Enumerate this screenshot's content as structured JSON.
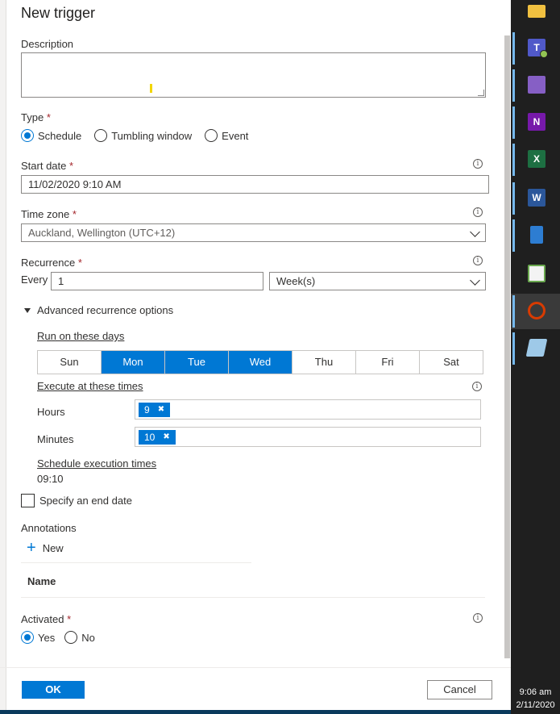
{
  "dialog": {
    "title": "New trigger",
    "description": {
      "label": "Description",
      "value": ""
    },
    "type": {
      "label": "Type",
      "required_mark": "*",
      "options": [
        {
          "label": "Schedule",
          "selected": true
        },
        {
          "label": "Tumbling window",
          "selected": false
        },
        {
          "label": "Event",
          "selected": false
        }
      ]
    },
    "start_date": {
      "label": "Start date",
      "required_mark": "*",
      "value": "11/02/2020 9:10 AM"
    },
    "time_zone": {
      "label": "Time zone",
      "required_mark": "*",
      "value": "Auckland, Wellington (UTC+12)"
    },
    "recurrence": {
      "label": "Recurrence",
      "required_mark": "*",
      "every_label": "Every",
      "interval": "1",
      "unit": "Week(s)"
    },
    "advanced": {
      "toggle_label": "Advanced recurrence options",
      "run_days_label": "Run on these days",
      "days": [
        {
          "label": "Sun",
          "selected": false
        },
        {
          "label": "Mon",
          "selected": true
        },
        {
          "label": "Tue",
          "selected": true
        },
        {
          "label": "Wed",
          "selected": true
        },
        {
          "label": "Thu",
          "selected": false
        },
        {
          "label": "Fri",
          "selected": false
        },
        {
          "label": "Sat",
          "selected": false
        }
      ],
      "execute_label": "Execute at these times",
      "hours_label": "Hours",
      "hours_tag": "9",
      "minutes_label": "Minutes",
      "minutes_tag": "10",
      "schedule_label": "Schedule execution times",
      "schedule_value": "09:10"
    },
    "end_date": {
      "label": "Specify an end date",
      "checked": false
    },
    "annotations": {
      "label": "Annotations",
      "new_label": "New",
      "column_name": "Name"
    },
    "activated": {
      "label": "Activated",
      "required_mark": "*",
      "options": [
        {
          "label": "Yes",
          "selected": true
        },
        {
          "label": "No",
          "selected": false
        }
      ]
    },
    "ok_label": "OK",
    "cancel_label": "Cancel"
  },
  "taskbar": {
    "time": "9:06 am",
    "date": "2/11/2020",
    "apps": [
      {
        "icon": "file-explorer-icon",
        "glyph": "",
        "color": "#f0c040"
      },
      {
        "icon": "teams-icon",
        "glyph": "T",
        "color": "#5059c9"
      },
      {
        "icon": "visual-studio-icon",
        "glyph": "",
        "color": "#865fc5"
      },
      {
        "icon": "onenote-icon",
        "glyph": "N",
        "color": "#7719aa"
      },
      {
        "icon": "excel-icon",
        "glyph": "X",
        "color": "#1d6f42"
      },
      {
        "icon": "word-icon",
        "glyph": "W",
        "color": "#2b579a"
      },
      {
        "icon": "calculator-icon",
        "glyph": "",
        "color": "#2d7dd2"
      },
      {
        "icon": "notepad-chart-icon",
        "glyph": "",
        "color": "#6aa84f"
      },
      {
        "icon": "snipping-tool-icon",
        "glyph": "",
        "color": "#d83b01"
      },
      {
        "icon": "eraser-app-icon",
        "glyph": "",
        "color": "#9ec9e8"
      }
    ]
  }
}
